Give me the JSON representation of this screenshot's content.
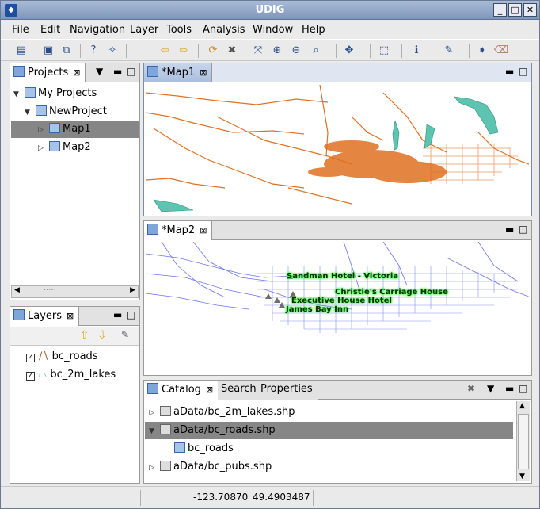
{
  "window": {
    "title": "UDIG"
  },
  "menu": [
    "File",
    "Edit",
    "Navigation",
    "Layer",
    "Tools",
    "Analysis",
    "Window",
    "Help"
  ],
  "toolbar_icons": [
    "new-icon",
    "save-icon",
    "save-all-icon",
    "help-icon",
    "wand-icon",
    "back-icon",
    "forward-icon",
    "refresh-icon",
    "stop-icon",
    "zoom-extent-icon",
    "zoom-in-icon",
    "zoom-out-icon",
    "zoom-select-icon",
    "pan-icon",
    "select-icon",
    "info-icon",
    "edit-tool-icon",
    "go-icon",
    "erase-icon"
  ],
  "projects": {
    "tab": "Projects",
    "items": [
      {
        "label": "My Projects",
        "level": 0,
        "expanded": true
      },
      {
        "label": "NewProject",
        "level": 1,
        "expanded": true
      },
      {
        "label": "Map1",
        "level": 2,
        "selected": true
      },
      {
        "label": "Map2",
        "level": 2
      }
    ],
    "scroll_dots": "....."
  },
  "layers": {
    "tab": "Layers",
    "items": [
      {
        "label": "bc_roads",
        "checked": true
      },
      {
        "label": "bc_2m_lakes",
        "checked": true
      }
    ]
  },
  "map1": {
    "tab": "*Map1"
  },
  "map2": {
    "tab": "*Map2",
    "labels": [
      "Sandman Hotel - Victoria",
      "Christie's Carriage House",
      "Executive House Hotel",
      "James Bay Inn"
    ]
  },
  "catalog": {
    "tabs": [
      "Catalog",
      "Search",
      "Properties"
    ],
    "items": [
      {
        "label": "aData/bc_2m_lakes.shp",
        "expanded": false
      },
      {
        "label": "aData/bc_roads.shp",
        "expanded": true,
        "selected": true
      },
      {
        "label": "bc_roads",
        "child": true
      },
      {
        "label": "aData/bc_pubs.shp",
        "expanded": false
      }
    ]
  },
  "status": {
    "x": "-123.70870",
    "y": "49.4903487"
  },
  "colors": {
    "roads": "#e07020",
    "lakes": "#5cc4b0",
    "roads2": "#6a74e8",
    "selection": "#868686"
  }
}
